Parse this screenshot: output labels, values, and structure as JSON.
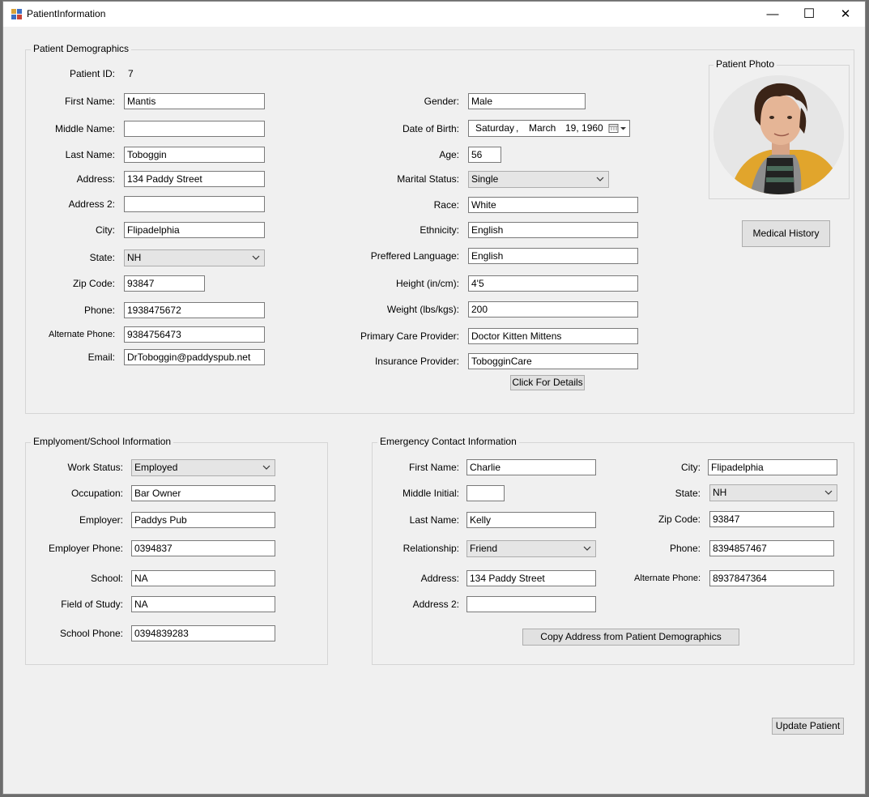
{
  "window": {
    "title": "PatientInformation",
    "minimize": "—",
    "maximize": "☐",
    "close": "✕"
  },
  "demographics": {
    "group_title": "Patient Demographics",
    "patient_id_label": "Patient ID:",
    "patient_id": "7",
    "first_name_label": "First Name:",
    "first_name": "Mantis",
    "middle_name_label": "Middle Name:",
    "middle_name": "",
    "last_name_label": "Last Name:",
    "last_name": "Toboggin",
    "address_label": "Address:",
    "address": "134 Paddy Street",
    "address2_label": "Address 2:",
    "address2": "",
    "city_label": "City:",
    "city": "Flipadelphia",
    "state_label": "State:",
    "state": "NH",
    "zip_label": "Zip Code:",
    "zip": "93847",
    "phone_label": "Phone:",
    "phone": "1938475672",
    "alt_phone_label": "Alternate Phone:",
    "alt_phone": "9384756473",
    "email_label": "Email:",
    "email": "DrToboggin@paddyspub.net",
    "gender_label": "Gender:",
    "gender": "Male",
    "dob_label": "Date of Birth:",
    "dob_day": "Saturday",
    "dob_sep": ",",
    "dob_month": "March",
    "dob_date": "19, 1960",
    "age_label": "Age:",
    "age": "56",
    "marital_label": "Marital Status:",
    "marital": "Single",
    "race_label": "Race:",
    "race": "White",
    "ethnicity_label": "Ethnicity:",
    "ethnicity": "English",
    "language_label": "Preffered Language:",
    "language": "English",
    "height_label": "Height (in/cm):",
    "height": "4'5",
    "weight_label": "Weight (lbs/kgs):",
    "weight": "200",
    "pcp_label": "Primary Care Provider:",
    "pcp": "Doctor Kitten Mittens",
    "insurance_label": "Insurance Provider:",
    "insurance": "TobogginCare",
    "details_button": "Click For Details"
  },
  "photo": {
    "group_title": "Patient Photo",
    "medical_history_button": "Medical History"
  },
  "employment": {
    "group_title": "Emplyoment/School Information",
    "work_status_label": "Work Status:",
    "work_status": "Employed",
    "occupation_label": "Occupation:",
    "occupation": "Bar Owner",
    "employer_label": "Employer:",
    "employer": "Paddys Pub",
    "employer_phone_label": "Employer Phone:",
    "employer_phone": "0394837",
    "school_label": "School:",
    "school": "NA",
    "field_label": "Field of Study:",
    "field": "NA",
    "school_phone_label": "School Phone:",
    "school_phone": "0394839283"
  },
  "emergency": {
    "group_title": "Emergency Contact Information",
    "first_name_label": "First Name:",
    "first_name": "Charlie",
    "middle_initial_label": "Middle Initial:",
    "middle_initial": "",
    "last_name_label": "Last Name:",
    "last_name": "Kelly",
    "relationship_label": "Relationship:",
    "relationship": "Friend",
    "address_label": "Address:",
    "address": "134 Paddy Street",
    "address2_label": "Address 2:",
    "address2": "",
    "city_label": "City:",
    "city": "Flipadelphia",
    "state_label": "State:",
    "state": "NH",
    "zip_label": "Zip Code:",
    "zip": "93847",
    "phone_label": "Phone:",
    "phone": "8394857467",
    "alt_phone_label": "Alternate Phone:",
    "alt_phone": "8937847364",
    "copy_button": "Copy Address from Patient Demographics"
  },
  "update_button": "Update Patient"
}
